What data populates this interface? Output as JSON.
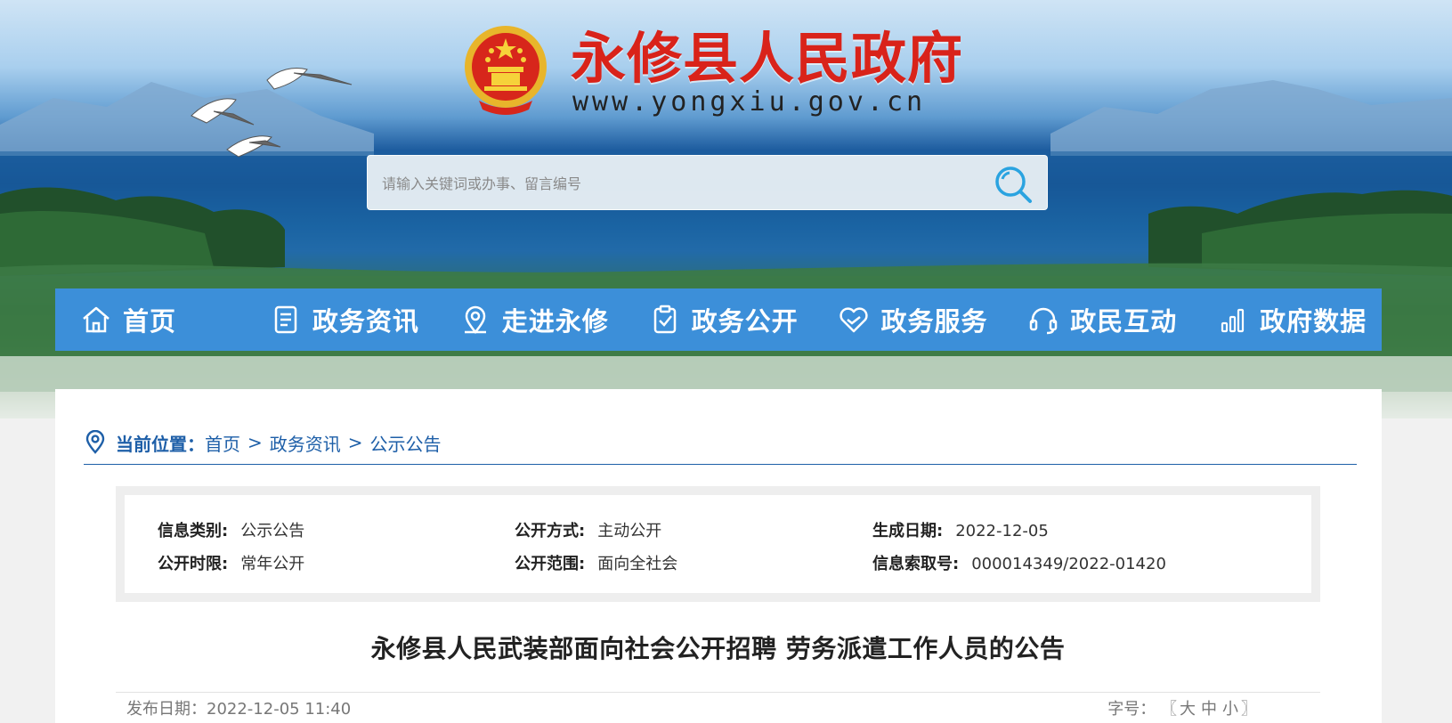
{
  "site": {
    "title": "永修县人民政府",
    "url": "www.yongxiu.gov.cn"
  },
  "search": {
    "placeholder": "请输入关键词或办事、留言编号"
  },
  "nav": {
    "items": [
      {
        "label": "首页",
        "icon": "home-icon"
      },
      {
        "label": "政务资讯",
        "icon": "document-icon"
      },
      {
        "label": "走进永修",
        "icon": "location-pin-icon"
      },
      {
        "label": "政务公开",
        "icon": "clipboard-check-icon"
      },
      {
        "label": "政务服务",
        "icon": "handshake-heart-icon"
      },
      {
        "label": "政民互动",
        "icon": "headset-icon"
      },
      {
        "label": "政府数据",
        "icon": "bar-chart-icon"
      }
    ]
  },
  "breadcrumb": {
    "label": "当前位置：",
    "items": [
      "首页",
      "政务资讯",
      "公示公告"
    ],
    "separator": ">"
  },
  "info": {
    "category_key": "信息类别:",
    "category_val": "公示公告",
    "method_key": "公开方式:",
    "method_val": "主动公开",
    "date_key": "生成日期:",
    "date_val": "2022-12-05",
    "period_key": "公开时限:",
    "period_val": "常年公开",
    "scope_key": "公开范围:",
    "scope_val": "面向全社会",
    "index_key": "信息索取号:",
    "index_val": "000014349/2022-01420"
  },
  "article": {
    "title": "永修县人民武装部面向社会公开招聘 劳务派遣工作人员的公告",
    "publish": "发布日期：2022-12-05 11:40",
    "fontsize_label": "字号：",
    "bracket_open": "〖",
    "size_large": "大",
    "size_medium": "中",
    "size_small": "小",
    "bracket_close": "〗"
  },
  "colors": {
    "nav_bg": "#3c8fd9",
    "title_red": "#d9231a",
    "link_blue": "#1e5fa8"
  }
}
